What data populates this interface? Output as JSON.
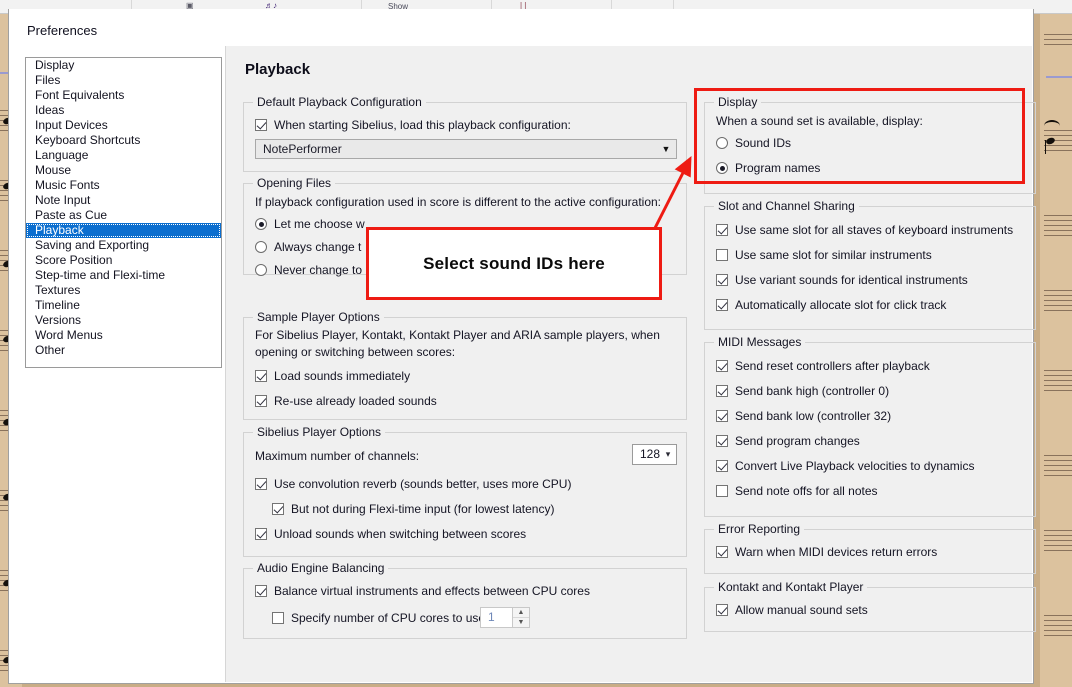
{
  "background": {
    "app": "sibelius-score",
    "ribbon_fragments": [
      "Show"
    ]
  },
  "dialog": {
    "title": "Preferences",
    "page_title": "Playback"
  },
  "sidebar": {
    "items": [
      {
        "label": "Display",
        "selected": false
      },
      {
        "label": "Files",
        "selected": false
      },
      {
        "label": "Font Equivalents",
        "selected": false
      },
      {
        "label": "Ideas",
        "selected": false
      },
      {
        "label": "Input Devices",
        "selected": false
      },
      {
        "label": "Keyboard Shortcuts",
        "selected": false
      },
      {
        "label": "Language",
        "selected": false
      },
      {
        "label": "Mouse",
        "selected": false
      },
      {
        "label": "Music Fonts",
        "selected": false
      },
      {
        "label": "Note Input",
        "selected": false
      },
      {
        "label": "Paste as Cue",
        "selected": false
      },
      {
        "label": "Playback",
        "selected": true
      },
      {
        "label": "Saving and Exporting",
        "selected": false
      },
      {
        "label": "Score Position",
        "selected": false
      },
      {
        "label": "Step-time and Flexi-time",
        "selected": false
      },
      {
        "label": "Textures",
        "selected": false
      },
      {
        "label": "Timeline",
        "selected": false
      },
      {
        "label": "Versions",
        "selected": false
      },
      {
        "label": "Word Menus",
        "selected": false
      },
      {
        "label": "Other",
        "selected": false
      }
    ]
  },
  "left_column": {
    "default_playback": {
      "caption": "Default Playback Configuration",
      "checkbox_label": "When starting Sibelius, load this playback configuration:",
      "checkbox_checked": true,
      "combo_value": "NotePerformer"
    },
    "opening_files": {
      "caption": "Opening Files",
      "description": "If playback configuration used in score is different to the active configuration:",
      "options": [
        {
          "label": "Let me choose w",
          "selected": true
        },
        {
          "label": "Always change t",
          "selected": false
        },
        {
          "label": "Never change to",
          "selected": false
        }
      ]
    },
    "sample_player": {
      "caption": "Sample Player Options",
      "description_line1": "For Sibelius Player, Kontakt, Kontakt Player and ARIA sample players, when",
      "description_line2": "opening or switching between scores:",
      "checkboxes": [
        {
          "label": "Load sounds immediately",
          "checked": true
        },
        {
          "label": "Re-use already loaded sounds",
          "checked": true
        }
      ]
    },
    "sibelius_player": {
      "caption": "Sibelius Player Options",
      "channels_label": "Maximum number of channels:",
      "channels_value": "128",
      "checkboxes": [
        {
          "label": "Use convolution reverb (sounds better, uses more CPU)",
          "checked": true,
          "indent": false
        },
        {
          "label": "But not during Flexi-time input (for lowest latency)",
          "checked": true,
          "indent": true
        },
        {
          "label": "Unload sounds when switching between scores",
          "checked": true,
          "indent": false
        }
      ]
    },
    "audio_engine": {
      "caption": "Audio Engine Balancing",
      "checkboxes": [
        {
          "label": "Balance virtual instruments and effects between CPU cores",
          "checked": true,
          "indent": false
        },
        {
          "label": "Specify number of CPU cores to use:",
          "checked": false,
          "indent": true
        }
      ],
      "cores_value": "1"
    }
  },
  "right_column": {
    "display": {
      "caption": "Display",
      "description": "When a sound set is available, display:",
      "options": [
        {
          "label": "Sound IDs",
          "selected": false
        },
        {
          "label": "Program names",
          "selected": true
        }
      ]
    },
    "slot_channel": {
      "caption": "Slot and Channel Sharing",
      "checkboxes": [
        {
          "label": "Use same slot for all staves of keyboard instruments",
          "checked": true
        },
        {
          "label": "Use same slot for similar instruments",
          "checked": false
        },
        {
          "label": "Use variant sounds for identical instruments",
          "checked": true
        },
        {
          "label": "Automatically allocate slot for click track",
          "checked": true
        }
      ]
    },
    "midi_messages": {
      "caption": "MIDI Messages",
      "checkboxes": [
        {
          "label": "Send reset controllers after playback",
          "checked": true
        },
        {
          "label": "Send bank high (controller 0)",
          "checked": true
        },
        {
          "label": "Send bank low (controller 32)",
          "checked": true
        },
        {
          "label": "Send program changes",
          "checked": true
        },
        {
          "label": "Convert Live Playback velocities to dynamics",
          "checked": true
        },
        {
          "label": "Send note offs for all notes",
          "checked": false
        }
      ]
    },
    "error_reporting": {
      "caption": "Error Reporting",
      "checkboxes": [
        {
          "label": "Warn when MIDI devices return errors",
          "checked": true
        }
      ]
    },
    "kontakt": {
      "caption": "Kontakt and Kontakt Player",
      "checkboxes": [
        {
          "label": "Allow manual sound sets",
          "checked": true
        }
      ]
    }
  },
  "annotations": {
    "callout_text": "Select sound IDs here",
    "highlight_color": "#ee1b13",
    "arrow_from": "callout box top-right",
    "arrow_to": "Display group (Sound IDs radio)"
  }
}
